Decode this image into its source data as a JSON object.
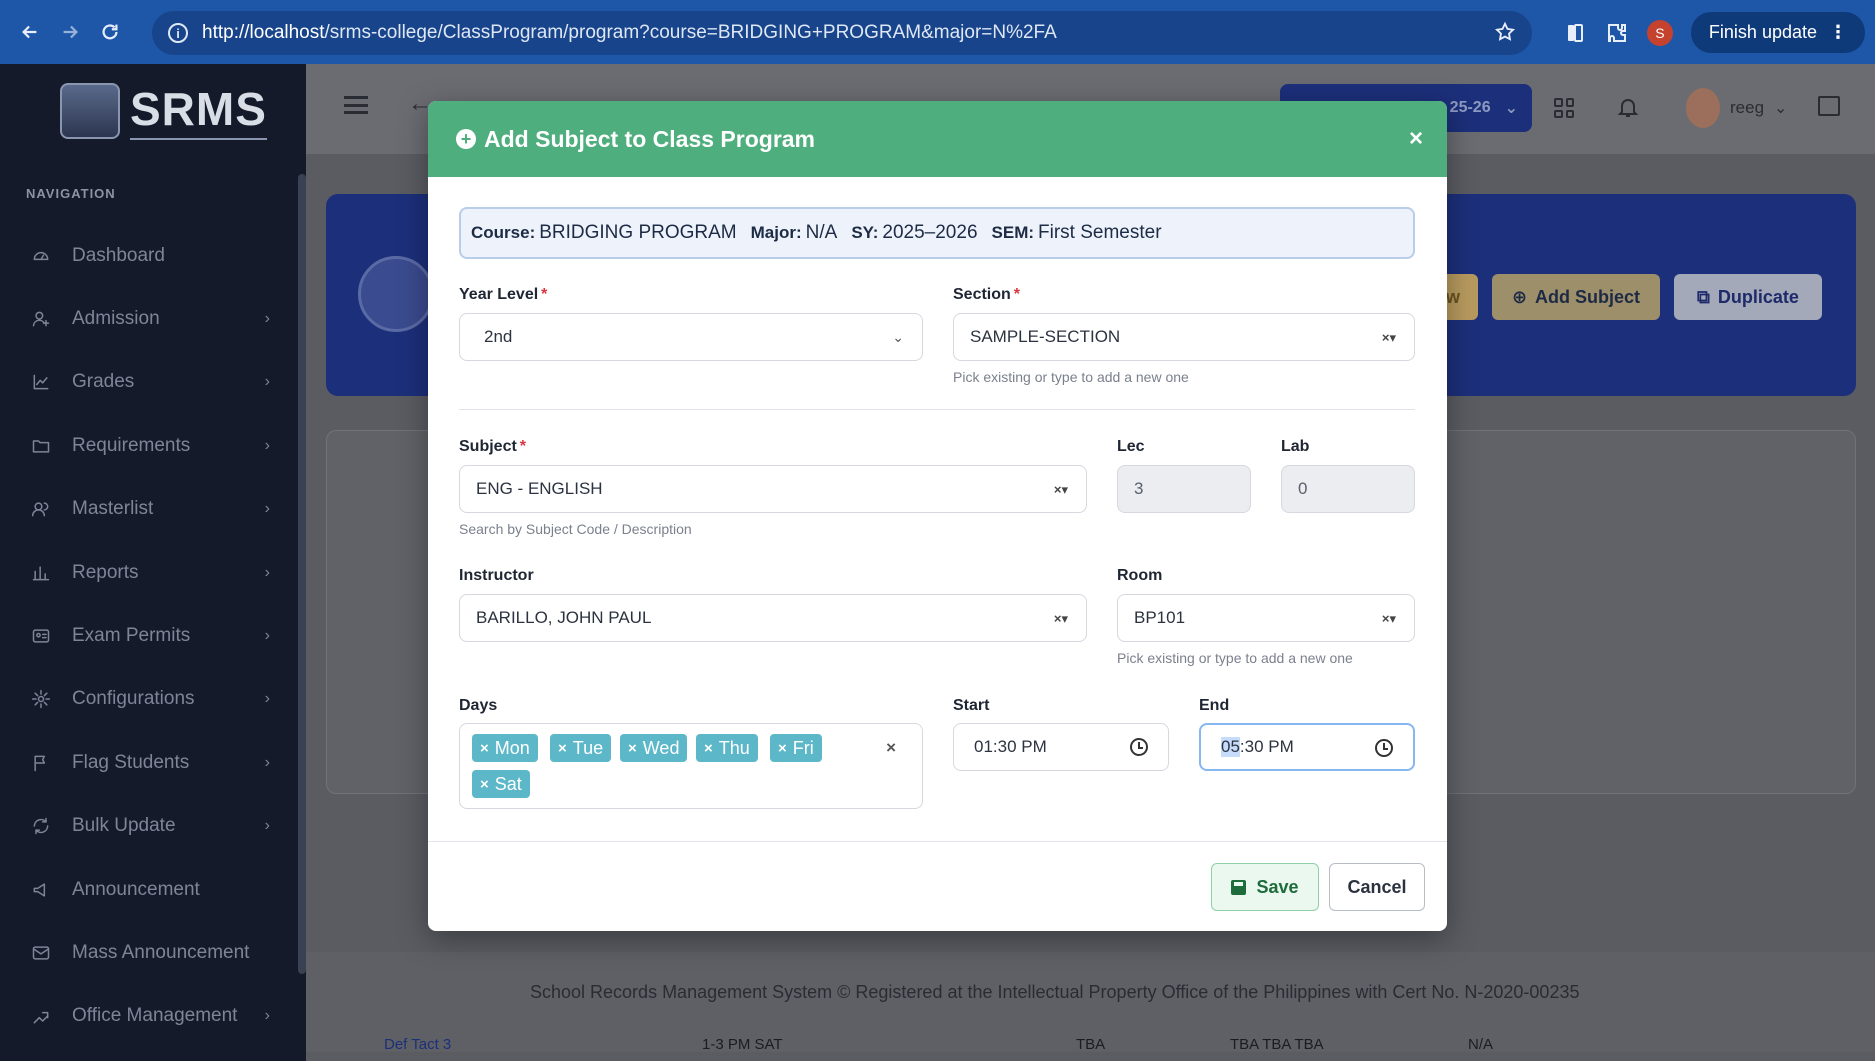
{
  "browser": {
    "url_host": "http://localhost",
    "url_path": "/srms-college/ClassProgram/program?course=BRIDGING+PROGRAM&major=N%2FA",
    "profile_initial": "S",
    "finish_update": "Finish update"
  },
  "sidebar": {
    "logo_text": "SRMS",
    "nav_label": "NAVIGATION",
    "items": [
      {
        "label": "Dashboard",
        "icon": "dashboard-icon",
        "has_children": false
      },
      {
        "label": "Admission",
        "icon": "user-add-icon",
        "has_children": true
      },
      {
        "label": "Grades",
        "icon": "chart-line-icon",
        "has_children": true
      },
      {
        "label": "Requirements",
        "icon": "folder-icon",
        "has_children": true
      },
      {
        "label": "Masterlist",
        "icon": "users-icon",
        "has_children": true
      },
      {
        "label": "Reports",
        "icon": "bar-chart-icon",
        "has_children": true
      },
      {
        "label": "Exam Permits",
        "icon": "id-card-icon",
        "has_children": true
      },
      {
        "label": "Configurations",
        "icon": "gear-icon",
        "has_children": true
      },
      {
        "label": "Flag Students",
        "icon": "flag-icon",
        "has_children": true
      },
      {
        "label": "Bulk Update",
        "icon": "refresh-icon",
        "has_children": true
      },
      {
        "label": "Announcement",
        "icon": "megaphone-icon",
        "has_children": false
      },
      {
        "label": "Mass Announcement",
        "icon": "mail-icon",
        "has_children": false
      },
      {
        "label": "Office Management",
        "icon": "office-icon",
        "has_children": true
      }
    ]
  },
  "header": {
    "school_year_badge": "25-26",
    "user": "reeg"
  },
  "hero": {
    "btn_partial": "w",
    "add_subject": "Add Subject",
    "duplicate": "Duplicate"
  },
  "footer": {
    "text": "School Records Management System © Registered at the Intellectual Property Office of the Philippines with ",
    "cert": "Cert No. N-2020-00235"
  },
  "peek_row": {
    "c1": "Def Tact 3",
    "c2": "1-3 PM SAT",
    "c3": "TBA",
    "c4": "TBA TBA TBA",
    "c5": "N/A"
  },
  "modal": {
    "title": "Add Subject to Class Program",
    "close": "×",
    "info": {
      "course_label": "Course:",
      "course": "BRIDGING PROGRAM",
      "major_label": "Major:",
      "major": "N/A",
      "sy_label": "SY:",
      "sy": "2025–2026",
      "sem_label": "SEM:",
      "sem": "First Semester"
    },
    "year_level": {
      "label": "Year Level",
      "value": "2nd"
    },
    "section": {
      "label": "Section",
      "value": "SAMPLE-SECTION",
      "hint": "Pick existing or type to add a new one"
    },
    "subject": {
      "label": "Subject",
      "value": "ENG - ENGLISH",
      "hint": "Search by Subject Code / Description"
    },
    "lec": {
      "label": "Lec",
      "value": "3"
    },
    "lab": {
      "label": "Lab",
      "value": "0"
    },
    "instructor": {
      "label": "Instructor",
      "value": "BARILLO, JOHN PAUL"
    },
    "room": {
      "label": "Room",
      "value": "BP101",
      "hint": "Pick existing or type to add a new one"
    },
    "days": {
      "label": "Days",
      "selected": [
        "Mon",
        "Tue",
        "Wed",
        "Thu",
        "Fri",
        "Sat"
      ],
      "clear": "×"
    },
    "start": {
      "label": "Start",
      "value": "01:30 PM"
    },
    "end": {
      "label": "End",
      "hour": "05",
      "rest": ":30 PM"
    },
    "save": "Save",
    "cancel": "Cancel",
    "required_mark": "*"
  },
  "colors": {
    "modal_header": "#4fae7d",
    "chip": "#5cb8c9",
    "hero": "#1c2f7a",
    "sidebar": "#141a29",
    "chrome": "#1f57a8"
  }
}
